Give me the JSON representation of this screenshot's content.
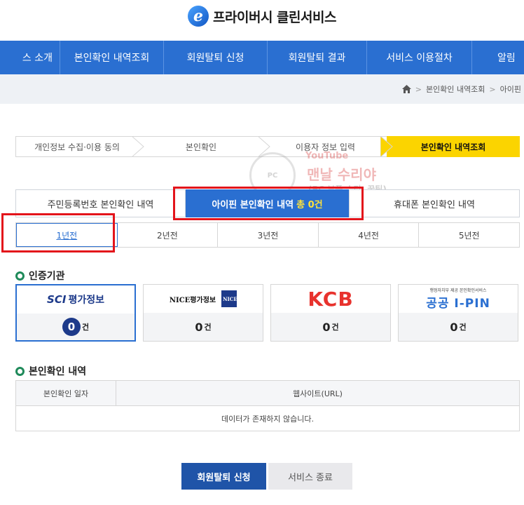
{
  "header": {
    "logo_letter": "e",
    "title": "프라이버시 클린서비스"
  },
  "nav": [
    "스 소개",
    "본인확인 내역조회",
    "회원탈퇴 신청",
    "회원탈퇴 결과",
    "서비스 이용절차",
    "알림"
  ],
  "breadcrumb": [
    "본인확인 내역조회",
    "아이핀"
  ],
  "steps": [
    "개인정보 수집·이용 동의",
    "본인확인",
    "이용자 정보 입력",
    "본인확인 내역조회"
  ],
  "watermark": {
    "badge": "PC",
    "youtube": "YouTube",
    "line1": "맨날 수리야",
    "line2": "(PC 부품 수리, 꿀팁)"
  },
  "tabs": [
    {
      "label": "주민등록번호 본인확인 내역"
    },
    {
      "label": "아이핀 본인확인 내역",
      "count": "총 0건"
    },
    {
      "label": "휴대폰 본인확인 내역"
    }
  ],
  "years": [
    "1년전",
    "2년전",
    "3년전",
    "4년전",
    "5년전"
  ],
  "section_agency": "인증기관",
  "agencies": [
    {
      "logo_a": "SCI",
      "logo_b": "평가정보",
      "count": "0",
      "unit": "건"
    },
    {
      "logo_a": "NICE평가정보",
      "logo_b": "NICE",
      "count": "0",
      "unit": "건"
    },
    {
      "logo_a": "KCB",
      "count": "0",
      "unit": "건"
    },
    {
      "logo_a": "행정자치부 제공 본인확인서비스",
      "logo_b": "공공 I-PIN",
      "count": "0",
      "unit": "건"
    }
  ],
  "section_history": "본인확인 내역",
  "table": {
    "headers": [
      "본인확인 일자",
      "웹사이트(URL)"
    ],
    "empty": "데이터가 존재하지 않습니다."
  },
  "buttons": {
    "primary": "회원탈퇴 신청",
    "secondary": "서비스 종료"
  },
  "colors": {
    "primary": "#2a6fd1",
    "step_active": "#fbd400",
    "highlight": "#e3141b"
  }
}
